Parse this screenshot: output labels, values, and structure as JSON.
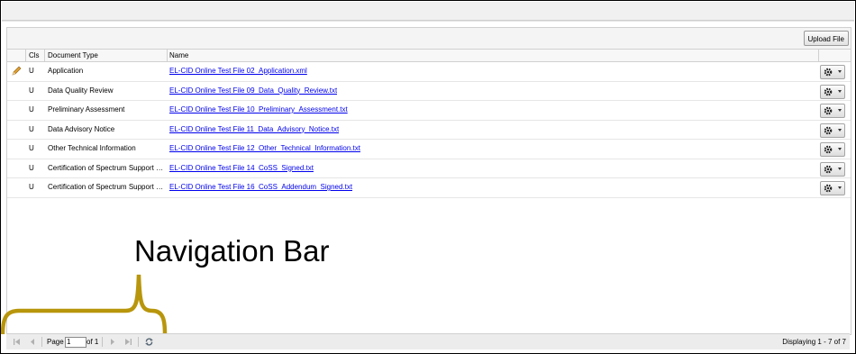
{
  "toolbar": {
    "upload_label": "Upload File"
  },
  "columns": {
    "cls": "Cls",
    "type": "Document Type",
    "name": "Name"
  },
  "rows": [
    {
      "cls": "U",
      "type": "Application",
      "name": "EL-CID Online Test File 02_Application.xml",
      "editable": true
    },
    {
      "cls": "U",
      "type": "Data Quality Review",
      "name": "EL-CID Online Test File 09_Data_Quality_Review.txt"
    },
    {
      "cls": "U",
      "type": "Preliminary Assessment",
      "name": "EL-CID Online Test File 10_Preliminary_Assessment.txt"
    },
    {
      "cls": "U",
      "type": "Data Advisory Notice",
      "name": "EL-CID Online Test File 11_Data_Advisory_Notice.txt"
    },
    {
      "cls": "U",
      "type": "Other Technical Information",
      "name": "EL-CID Online Test File 12_Other_Technical_Information.txt"
    },
    {
      "cls": "U",
      "type": "Certification of Spectrum Support (Si...",
      "name": "EL-CID Online Test File 14_CoSS_Signed.txt"
    },
    {
      "cls": "U",
      "type": "Certification of Spectrum Support - ...",
      "name": "EL-CID Online Test File 16_CoSS_Addendum_Signed.txt"
    }
  ],
  "callout": {
    "label": "Navigation Bar"
  },
  "pager": {
    "page_label": "Page",
    "page_value": "1",
    "of_label": "of 1",
    "display_text": "Displaying 1 - 7 of 7"
  },
  "icons": {
    "row_edit": "pencil-icon",
    "row_action": "gear-icon",
    "pager": [
      "first-page-icon",
      "prev-page-icon",
      "next-page-icon",
      "last-page-icon",
      "refresh-icon"
    ]
  },
  "colors": {
    "link": "#0000ee",
    "callout_bracket": "#b8960c"
  }
}
